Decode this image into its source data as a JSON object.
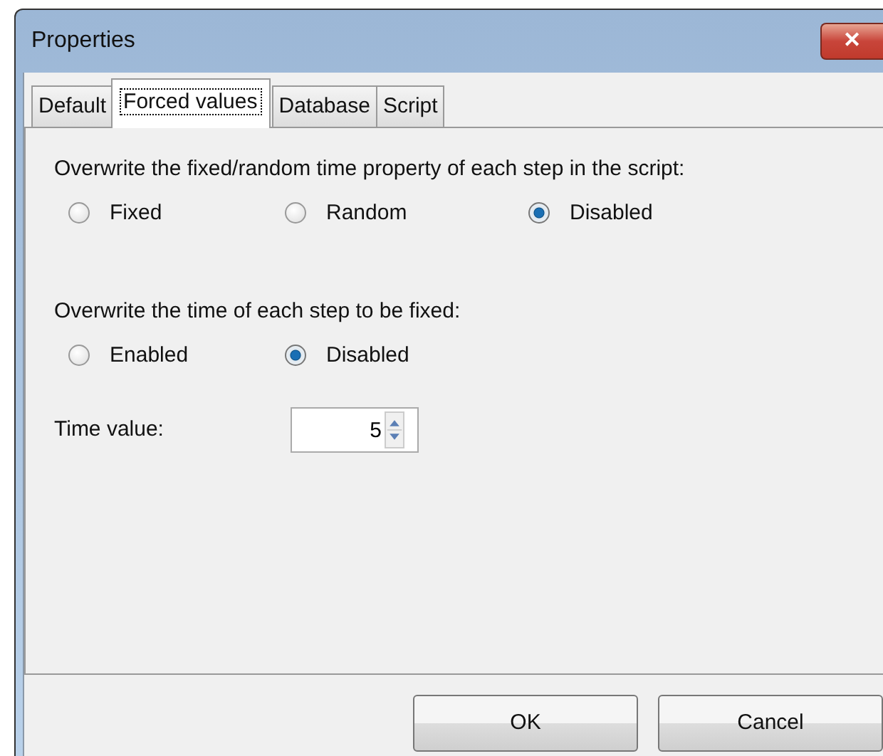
{
  "window": {
    "title": "Properties",
    "close": "✕"
  },
  "tabs": [
    {
      "label": "Default",
      "selected": false
    },
    {
      "label": "Forced values",
      "selected": true
    },
    {
      "label": "Database",
      "selected": false
    },
    {
      "label": "Script",
      "selected": false
    }
  ],
  "groups": [
    {
      "label": "Overwrite the fixed/random time property of each step in the script:",
      "options": [
        {
          "label": "Fixed",
          "selected": false
        },
        {
          "label": "Random",
          "selected": false
        },
        {
          "label": "Disabled",
          "selected": true
        }
      ]
    },
    {
      "label": "Overwrite the time of each step to be fixed:",
      "options": [
        {
          "label": "Enabled",
          "selected": false
        },
        {
          "label": "Disabled",
          "selected": true
        }
      ]
    }
  ],
  "time_value": {
    "label": "Time value:",
    "value": "5"
  },
  "buttons": [
    "OK",
    "Cancel"
  ]
}
